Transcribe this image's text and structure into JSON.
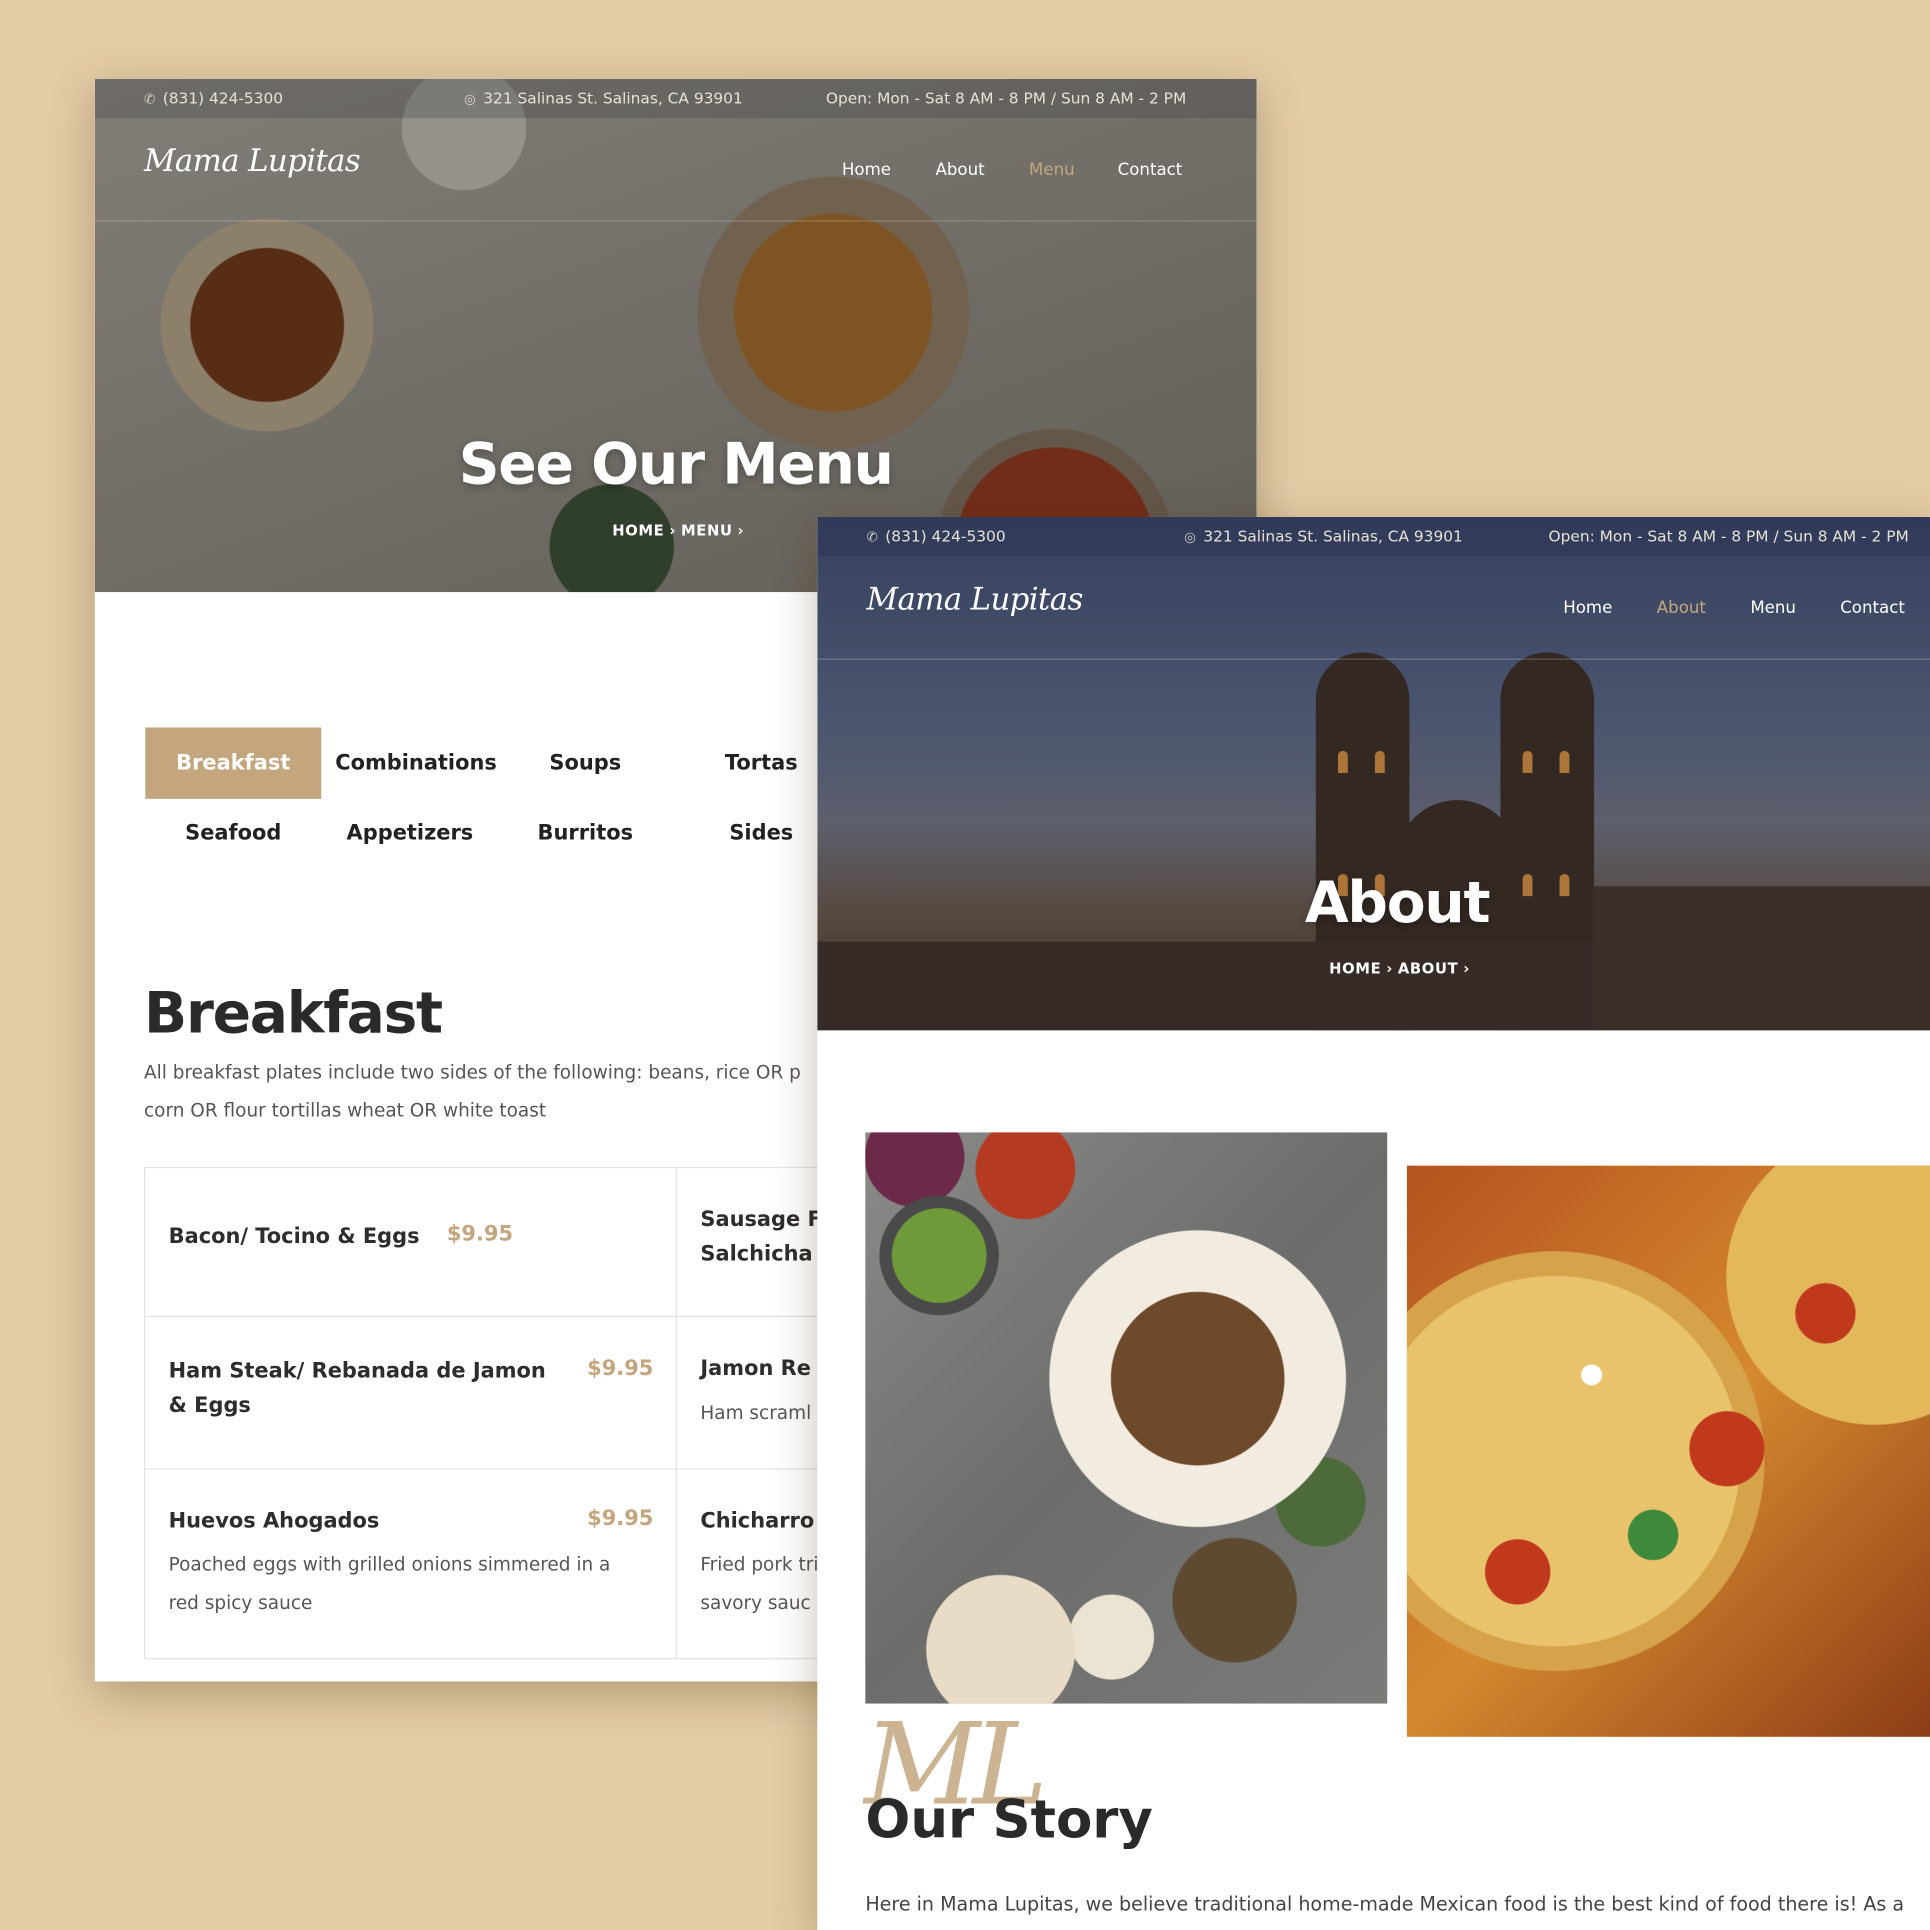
{
  "info": {
    "phone": "(831) 424-5300",
    "address_menu": "321 Salinas St. Salinas, CA 93901",
    "address_about": "321 Salinas St. Salinas, CA 93901",
    "hours": "Open: Mon - Sat 8 AM - 8 PM / Sun 8 AM - 2 PM"
  },
  "brand": {
    "logo_text": "Mama Lupitas",
    "accent": "#c4a67e",
    "background": "#e3cba5"
  },
  "nav": {
    "home": "Home",
    "about": "About",
    "menu": "Menu",
    "contact": "Contact"
  },
  "menu_page": {
    "title": "See Our Menu",
    "breadcrumb": [
      "HOME",
      "MENU"
    ],
    "tabs": [
      "Breakfast",
      "Combinations",
      "Soups",
      "Tortas",
      "Seafood",
      "Appetizers",
      "Burritos",
      "Sides"
    ],
    "active_tab": "Breakfast",
    "section_title": "Breakfast",
    "section_desc": "All breakfast plates include two sides of the following: beans, rice OR p\ncorn OR flour tortillas wheat OR white toast",
    "items": [
      {
        "name": "Bacon/ Tocino & Eggs",
        "price": "$9.95",
        "desc": ""
      },
      {
        "name": "Sausage F\nSalchicha",
        "price": "",
        "desc": ""
      },
      {
        "name": "Ham Steak/ Rebanada de Jamon\n& Eggs",
        "price": "$9.95",
        "desc": ""
      },
      {
        "name": "Jamon Re",
        "price": "",
        "desc": "Ham scraml"
      },
      {
        "name": "Huevos Ahogados",
        "price": "$9.95",
        "desc": "Poached eggs with grilled onions simmered in a\nred spicy sauce"
      },
      {
        "name": "Chicharro",
        "price": "",
        "desc": "Fried pork tri\nsavory sauc"
      }
    ]
  },
  "about_page": {
    "title": "About",
    "breadcrumb": [
      "HOME",
      "ABOUT"
    ],
    "monogram": "ML",
    "story_title": "Our Story",
    "story_text": "Here in Mama Lupitas, we believe traditional home-made Mexican food is the best kind of food there is! As a"
  }
}
